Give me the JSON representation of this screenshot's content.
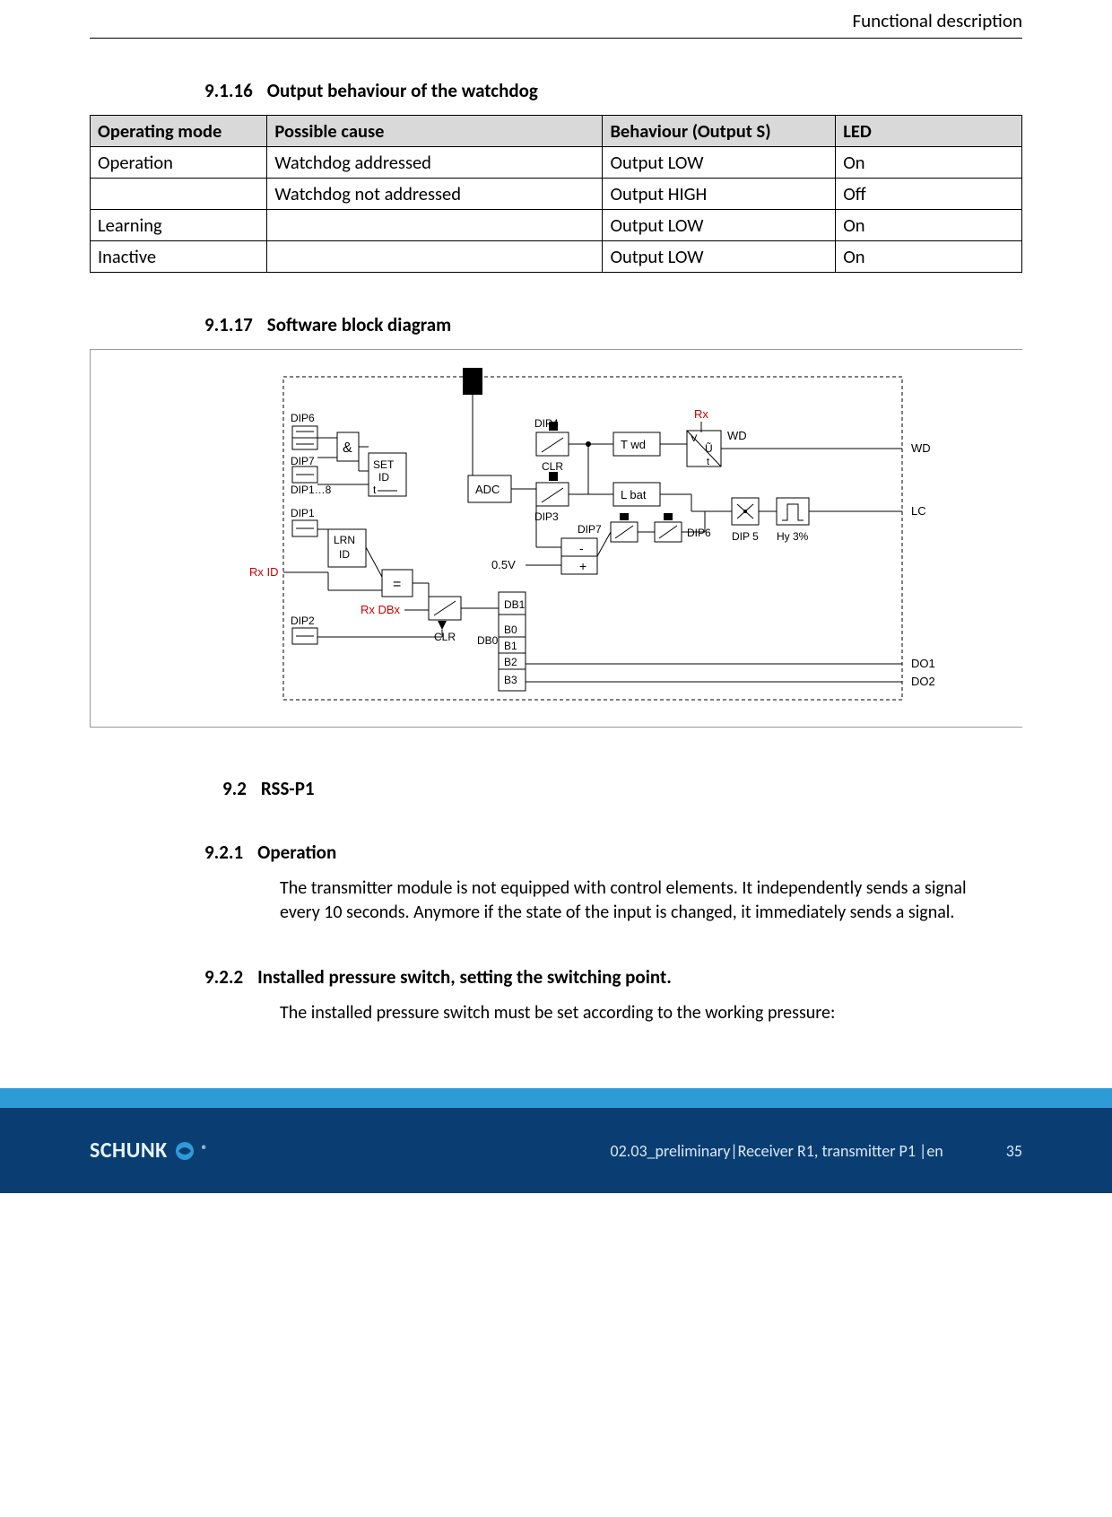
{
  "header": {
    "section_title": "Functional description"
  },
  "sections": {
    "s1": {
      "num": "9.1.16",
      "title": "Output behaviour of the watchdog"
    },
    "s2": {
      "num": "9.1.17",
      "title": "Software block diagram"
    },
    "s3": {
      "num": "9.2",
      "title": "RSS-P1"
    },
    "s4": {
      "num": "9.2.1",
      "title": "Operation"
    },
    "s5": {
      "num": "9.2.2",
      "title": "Installed pressure switch, setting the switching point."
    }
  },
  "table_9_1_16": {
    "headers": [
      "Operating mode",
      "Possible cause",
      "Behaviour (Output S)",
      "LED"
    ],
    "rows": [
      [
        "Operation",
        "Watchdog addressed",
        "Output LOW",
        "On"
      ],
      [
        "",
        "Watchdog not addressed",
        "Output HIGH",
        "Off"
      ],
      [
        "Learning",
        "",
        "Output LOW",
        "On"
      ],
      [
        "Inactive",
        "",
        "Output LOW",
        "On"
      ]
    ]
  },
  "paragraphs": {
    "p_921": "The transmitter module is not equipped with control elements. It independently sends a signal every 10 seconds. Anymore if the state of the input is changed, it immediately sends a signal.",
    "p_922": "The installed pressure switch must be set according to the working pressure:"
  },
  "diagram_labels": {
    "DIP6": "DIP6",
    "DIP7": "DIP7",
    "DIP1_8": "DIP1…8",
    "DIP1": "DIP1",
    "DIP2": "DIP2",
    "DIP3": "DIP3",
    "DIP4": "DIP4",
    "DIP5": "DIP 5",
    "DIP7b": "DIP7",
    "DIP6b": "DIP6",
    "SET_ID": "SET\nID",
    "LRN_ID": "LRN\nID",
    "EQ": "=",
    "AMP": "&",
    "ADC": "ADC",
    "CLR": "CLR",
    "CLR2": "CLR",
    "Twd": "T wd",
    "Lbat": "L bat",
    "Rx": "Rx",
    "RxID": "Rx ID",
    "RxDBx": "Rx DBx",
    "V05": "0.5V",
    "Hy": "Hy 3%",
    "U": "Ũ",
    "V": "V",
    "t": "t",
    "WD": "WD",
    "WD2": "WD",
    "LC": "LC",
    "DO1": "DO1",
    "DO2": "DO2",
    "DB1": "DB1",
    "DB0": "DB0",
    "B0": "B0",
    "B1": "B1",
    "B2": "B2",
    "B3": "B3",
    "tpulse": "t"
  },
  "footer": {
    "logo": "SCHUNK",
    "doc": "02.03_preliminary|Receiver R1, transmitter P1 |en",
    "page": "35"
  }
}
